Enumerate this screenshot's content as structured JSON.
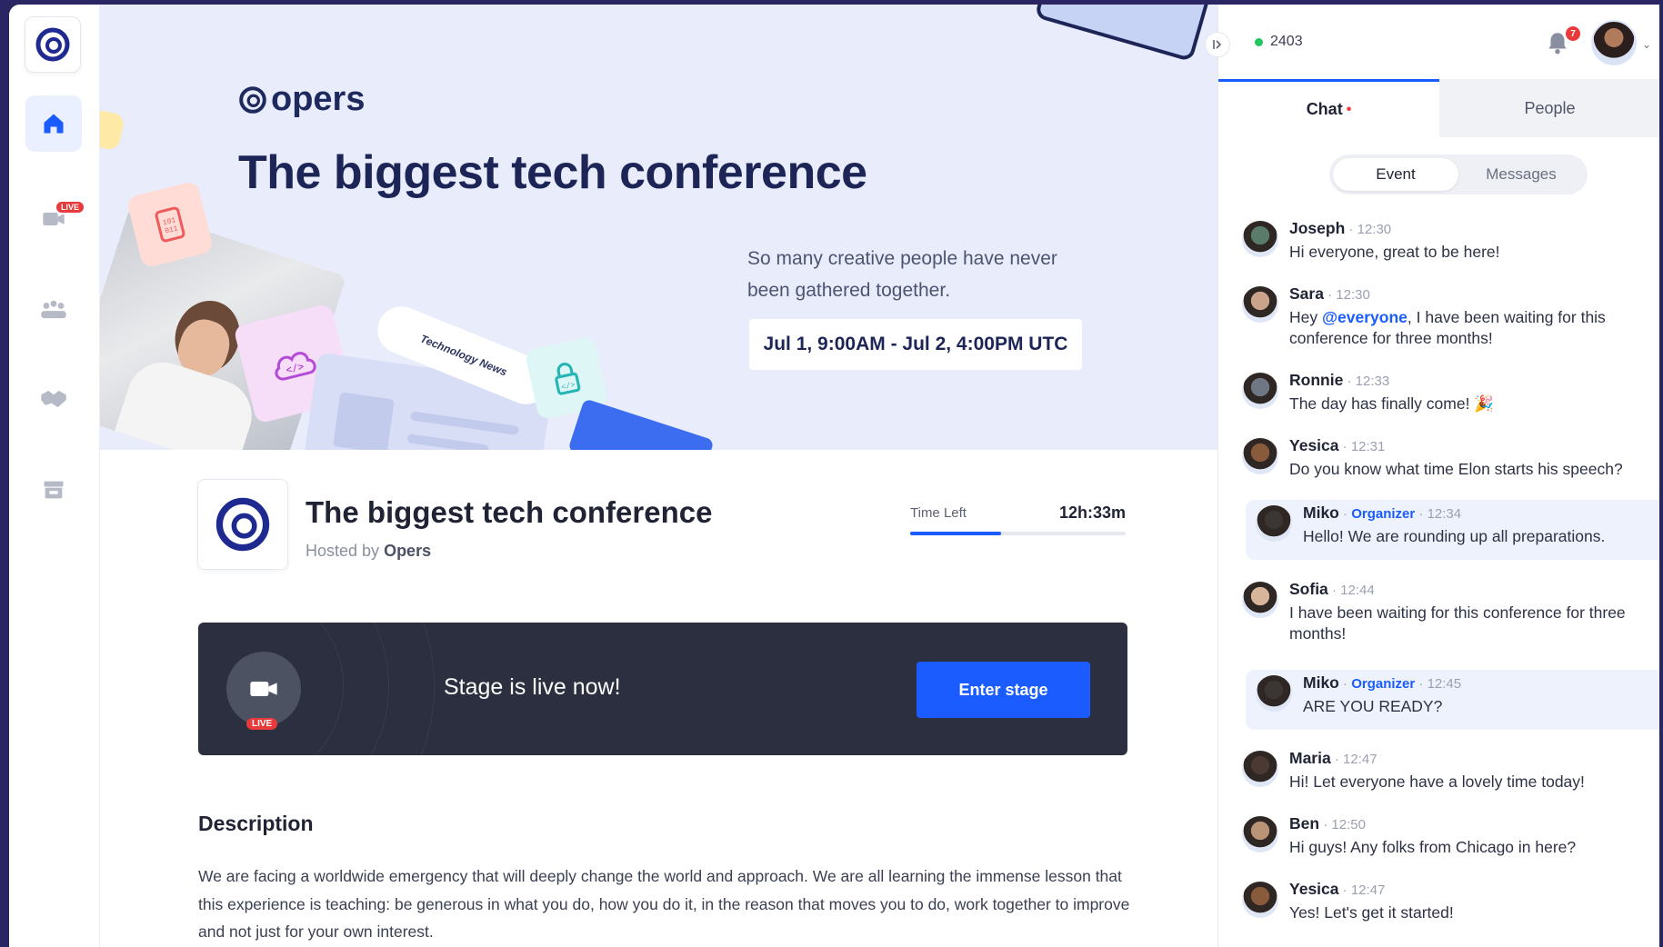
{
  "app": {
    "brand": "opers"
  },
  "rail": {
    "items": [
      {
        "name": "home",
        "badge": ""
      },
      {
        "name": "stage",
        "badge": "LIVE"
      },
      {
        "name": "sessions",
        "badge": ""
      },
      {
        "name": "networking",
        "badge": ""
      },
      {
        "name": "expo",
        "badge": ""
      }
    ]
  },
  "hero": {
    "brand": "opers",
    "title": "The biggest tech conference",
    "subtitle": "So many creative people have never been gathered together.",
    "date_range": "Jul 1, 9:00AM - Jul 2, 4:00PM UTC",
    "tech_pill": "Technology News"
  },
  "event": {
    "title": "The biggest tech conference",
    "hosted_by_prefix": "Hosted by",
    "host": "Opers",
    "time_left_label": "Time Left",
    "time_left_value": "12h:33m",
    "time_left_fraction": 0.42
  },
  "stage": {
    "live_badge": "LIVE",
    "message": "Stage is live now!",
    "cta": "Enter stage"
  },
  "description": {
    "title": "Description",
    "body": "We are facing a worldwide emergency that will deeply change the world and approach. We are all learning the immense lesson that this experience is teaching: be generous in what you do, how you do it, in the reason that moves you to do, work together to improve and not just for your own interest."
  },
  "panel": {
    "online_count": "2403",
    "notification_count": "7",
    "tabs": [
      {
        "label": "Chat",
        "active": true,
        "unread": "•"
      },
      {
        "label": "People",
        "active": false,
        "unread": ""
      }
    ],
    "segments": [
      {
        "label": "Event",
        "active": true
      },
      {
        "label": "Messages",
        "active": false
      }
    ],
    "messages": [
      {
        "name": "Joseph",
        "role": "",
        "time": "12:30",
        "text": "Hi everyone, great to be here!",
        "avatar": "#5a7a6a"
      },
      {
        "name": "Sara",
        "role": "",
        "time": "12:30",
        "mention": "@everyone",
        "pre": "Hey ",
        "text": ", I have been waiting for this conference for three months!",
        "avatar": "#c9a48a"
      },
      {
        "name": "Ronnie",
        "role": "",
        "time": "12:33",
        "text": "The day has finally come! 🎉",
        "avatar": "#6f7684"
      },
      {
        "name": "Yesica",
        "role": "",
        "time": "12:31",
        "text": "Do you know what time Elon starts his speech?",
        "avatar": "#8a5a3c"
      },
      {
        "name": "Miko",
        "role": "Organizer",
        "time": "12:34",
        "text": "Hello! We are rounding up all preparations.",
        "avatar": "#3b3533"
      },
      {
        "name": "Sofia",
        "role": "",
        "time": "12:44",
        "text": "I have been waiting for this conference for three months!",
        "avatar": "#d7b59b"
      },
      {
        "name": "Miko",
        "role": "Organizer",
        "time": "12:45",
        "text": "ARE YOU READY?",
        "avatar": "#3b3533"
      },
      {
        "name": "Maria",
        "role": "",
        "time": "12:47",
        "text": "Hi! Let everyone have a lovely time today!",
        "avatar": "#4a3a33"
      },
      {
        "name": "Ben",
        "role": "",
        "time": "12:50",
        "text": "Hi guys! Any folks from Chicago in here?",
        "avatar": "#b99477"
      },
      {
        "name": "Yesica",
        "role": "",
        "time": "12:47",
        "text": "Yes! Let's get it started!",
        "avatar": "#8a5a3c"
      }
    ]
  },
  "colors": {
    "accent": "#1a5cff",
    "live": "#e83a3a",
    "stage_bg": "#2b2f3f",
    "hero_bg": "#e9edfb"
  }
}
